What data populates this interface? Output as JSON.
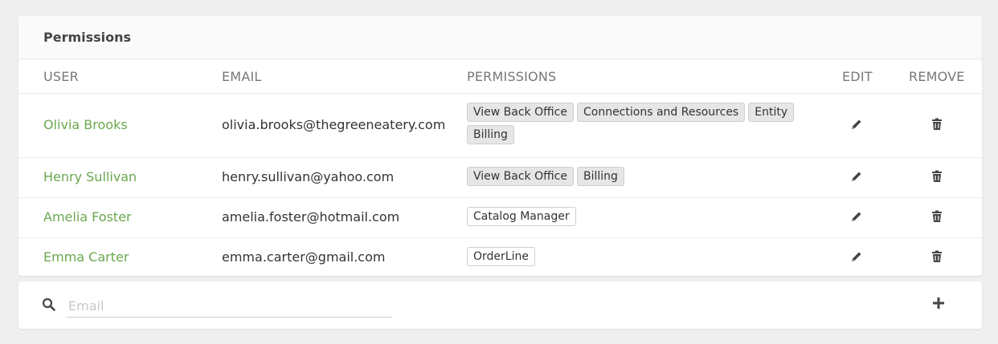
{
  "panel": {
    "title": "Permissions"
  },
  "table": {
    "headers": {
      "user": "USER",
      "email": "EMAIL",
      "permissions": "PERMISSIONS",
      "edit": "EDIT",
      "remove": "REMOVE"
    },
    "rows": [
      {
        "user": "Olivia Brooks",
        "email": "olivia.brooks@thegreeneatery.com",
        "permissions": [
          "View Back Office",
          "Connections and Resources",
          "Entity",
          "Billing"
        ]
      },
      {
        "user": "Henry Sullivan",
        "email": "henry.sullivan@yahoo.com",
        "permissions": [
          "View Back Office",
          "Billing"
        ]
      },
      {
        "user": "Amelia Foster",
        "email": "amelia.foster@hotmail.com",
        "permissions": [
          "Catalog Manager"
        ]
      },
      {
        "user": "Emma Carter",
        "email": "emma.carter@gmail.com",
        "permissions": [
          "OrderLine"
        ]
      }
    ]
  },
  "search": {
    "placeholder": "Email",
    "value": ""
  },
  "icons": {
    "search": "search-icon",
    "edit": "pencil-icon",
    "remove": "trash-icon",
    "add": "plus-icon"
  },
  "colors": {
    "user_link": "#6aa84f",
    "background": "#efefef"
  }
}
